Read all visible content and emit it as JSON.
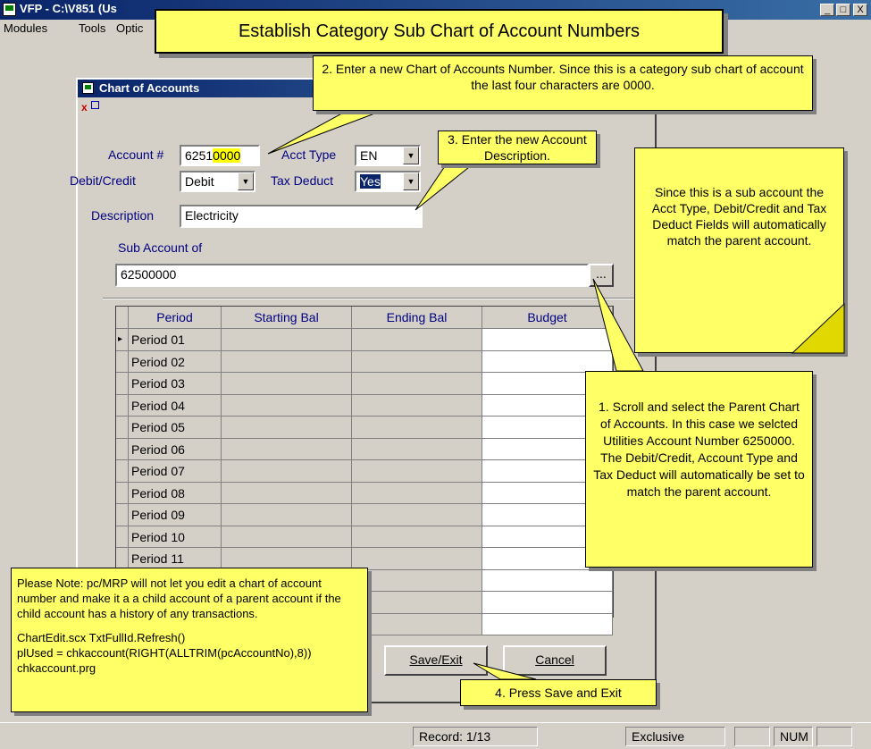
{
  "app": {
    "title": "VFP - C:\\V851 (Us",
    "menu": [
      "Modules",
      "Tools",
      "Optic"
    ],
    "min_btn": "_",
    "max_btn": "□",
    "close_btn": "X"
  },
  "banner": {
    "text": "Establish Category Sub Chart of Account Numbers"
  },
  "form": {
    "title": "Chart of Accounts",
    "account_label": "Account #",
    "account_prefix": "6251",
    "account_suffix": "0000",
    "acct_type_label": "Acct Type",
    "acct_type_value": "EN",
    "debit_credit_label": "Debit/Credit",
    "debit_credit_value": "Debit",
    "tax_deduct_label": "Tax Deduct",
    "tax_deduct_value": "Yes",
    "description_label": "Description",
    "description_value": "Electricity",
    "sub_account_label": "Sub Account of",
    "sub_account_value": "62500000",
    "browse_btn": "..."
  },
  "grid": {
    "headers": [
      "Period",
      "Starting Bal",
      "Ending Bal",
      "Budget"
    ],
    "rows": [
      "Period 01",
      "Period 02",
      "Period 03",
      "Period 04",
      "Period 05",
      "Period 06",
      "Period 07",
      "Period 08",
      "Period 09",
      "Period 10",
      "Period 11",
      "",
      "",
      ""
    ]
  },
  "buttons": {
    "save": "Save/Exit",
    "cancel": "Cancel"
  },
  "status": {
    "record": "Record: 1/13",
    "mode": "Exclusive",
    "num": "NUM"
  },
  "callouts": {
    "step1": "1. Scroll and select the Parent Chart of Accounts.  In this case we selcted Utilities Account Number 6250000. The Debit/Credit, Account Type and Tax Deduct will automatically be set to match the parent account.",
    "step2": "2. Enter a new Chart of Accounts Number.  Since this is a category sub chart of account the last four characters are 0000.",
    "step3": "3. Enter the new Account Description.",
    "step4": "4. Press Save and Exit",
    "sub_note": "Since this is a sub account the Acct Type, Debit/Credit and Tax Deduct Fields will automatically match the parent account.",
    "note_p1": "Please Note: pc/MRP will not let you edit a chart of account number and make it a a child account of a parent account if the child account has a history of any transactions.",
    "note_l1": "ChartEdit.scx TxtFullId.Refresh()",
    "note_l2": "plUsed = chkaccount(RIGHT(ALLTRIM(pcAccountNo),8))",
    "note_l3": "chkaccount.prg"
  }
}
